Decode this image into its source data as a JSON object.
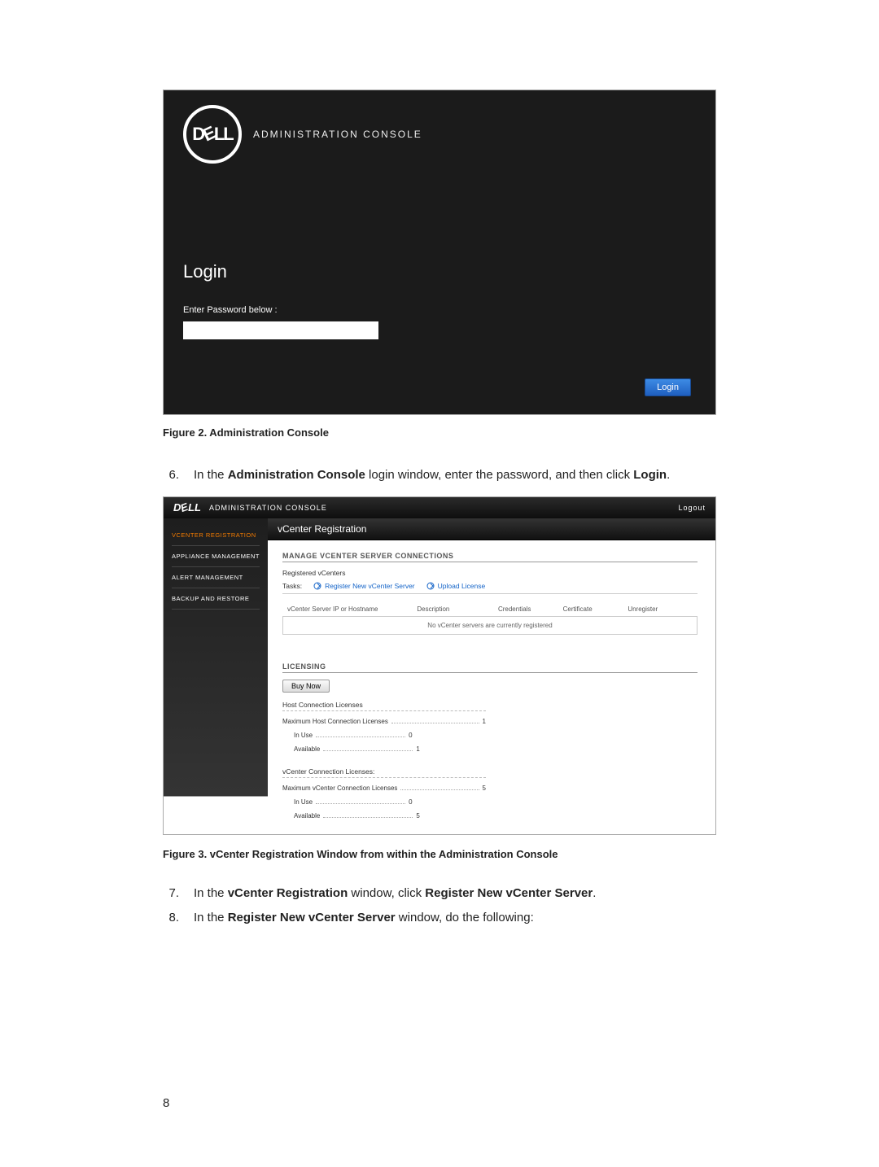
{
  "figure2": {
    "caption": "Figure 2. Administration Console",
    "header_title": "ADMINISTRATION CONSOLE",
    "login_heading": "Login",
    "password_label": "Enter Password below :",
    "login_button": "Login"
  },
  "steps": {
    "s6_num": "6.",
    "s6_pre": "In the ",
    "s6_b1": "Administration Console",
    "s6_mid": " login window, enter the password, and then click ",
    "s6_b2": "Login",
    "s6_post": ".",
    "s7_num": "7.",
    "s7_pre": "In the ",
    "s7_b1": "vCenter Registration",
    "s7_mid": " window, click ",
    "s7_b2": "Register New vCenter Server",
    "s7_post": ".",
    "s8_num": "8.",
    "s8_pre": "In the ",
    "s8_b1": "Register New vCenter Server",
    "s8_post": " window, do the following:"
  },
  "figure3": {
    "caption": "Figure 3. vCenter Registration Window from within the Administration Console",
    "topbar_title": "ADMINISTRATION CONSOLE",
    "logout": "Logout",
    "sidebar": {
      "items": [
        {
          "label": "VCENTER REGISTRATION"
        },
        {
          "label": "APPLIANCE MANAGEMENT"
        },
        {
          "label": "ALERT MANAGEMENT"
        },
        {
          "label": "BACKUP AND RESTORE"
        }
      ]
    },
    "main": {
      "title": "vCenter Registration",
      "manage_heading": "MANAGE VCENTER SERVER CONNECTIONS",
      "registered_label": "Registered vCenters",
      "tasks_label": "Tasks:",
      "task_register": "Register New vCenter Server",
      "task_upload": "Upload License",
      "columns": {
        "ip": "vCenter Server IP or Hostname",
        "desc": "Description",
        "cred": "Credentials",
        "cert": "Certificate",
        "unreg": "Unregister"
      },
      "empty_msg": "No vCenter servers are currently registered",
      "licensing_heading": "LICENSING",
      "buy_now": "Buy Now",
      "host_licenses_title": "Host Connection Licenses",
      "host": {
        "max_label": "Maximum Host Connection Licenses",
        "max_value": "1",
        "inuse_label": "In Use",
        "inuse_value": "0",
        "avail_label": "Available",
        "avail_value": "1"
      },
      "vcenter_licenses_title": "vCenter Connection Licenses:",
      "vcenter": {
        "max_label": "Maximum vCenter Connection Licenses",
        "max_value": "5",
        "inuse_label": "In Use",
        "inuse_value": "0",
        "avail_label": "Available",
        "avail_value": "5"
      }
    }
  },
  "page_number": "8"
}
